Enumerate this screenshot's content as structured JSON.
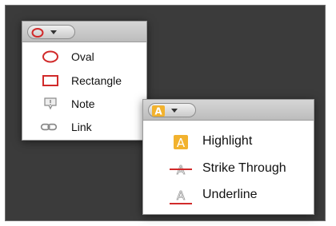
{
  "shapes_menu": {
    "items": [
      {
        "label": "Oval",
        "icon": "oval-icon",
        "color": "#d12a2a"
      },
      {
        "label": "Rectangle",
        "icon": "rectangle-icon",
        "color": "#d12a2a"
      },
      {
        "label": "Note",
        "icon": "note-icon",
        "color": "#8a8a8a"
      },
      {
        "label": "Link",
        "icon": "link-icon",
        "color": "#8a8a8a"
      }
    ]
  },
  "text_menu": {
    "button_glyph": "A",
    "items": [
      {
        "label": "Highlight",
        "icon": "highlight-icon",
        "glyph": "A",
        "color": "#f2b22e"
      },
      {
        "label": "Strike Through",
        "icon": "strike-through-icon",
        "glyph": "A",
        "color": "#d12a2a"
      },
      {
        "label": "Underline",
        "icon": "underline-icon",
        "glyph": "A",
        "color": "#d12a2a"
      }
    ]
  }
}
